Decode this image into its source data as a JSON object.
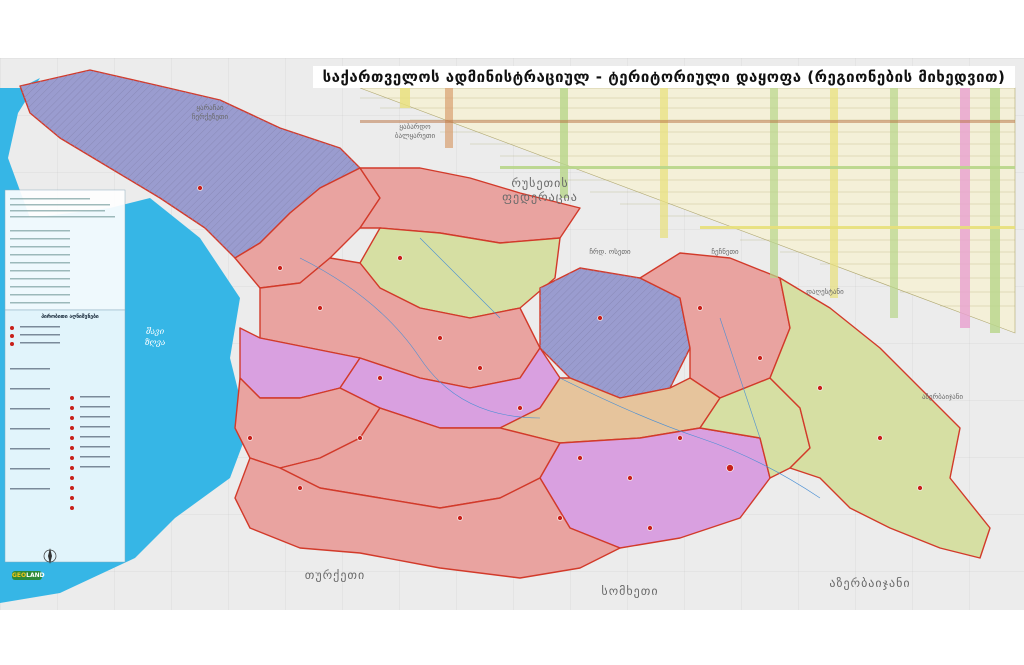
{
  "map": {
    "title": "საქართველოს ადმინისტრაციულ - ტერიტორიული დაყოფა (რეგიონების მიხედვით)",
    "countries": {
      "russia": "რუსეთის ფედერაცია",
      "turkey": "თურქეთი",
      "armenia": "სომხეთი",
      "azerbaijan": "აზერბაიჯანი"
    },
    "sea": "შავი ზღვა",
    "regions_small": {
      "north_west": "ყარაჩაი ჩერქეზეთი",
      "north_center": "ყაბარდო ბალყარეთი",
      "north_ossetia": "ჩრდ. ოსეთი",
      "chechnya": "ჩეჩნეთი",
      "dagestan": "დაღესტანი",
      "azerbaijan_small": "აზერბაიჯანი"
    },
    "legend_header": "პირობითი აღნიშვნები",
    "logo": {
      "geo": "GEO",
      "land": "LAND"
    }
  },
  "colors": {
    "sea": "#36b6e6",
    "land_outside": "#ececec",
    "region_pink": "#e9a3a0",
    "region_purple": "#d9a0e0",
    "region_blue": "#9a9ccf",
    "region_green": "#d6dfa3",
    "region_tan": "#e6c49c",
    "border_red": "#d23a2a",
    "table_yellow": "#e8e07a",
    "table_green": "#b8d68a",
    "table_pink": "#e8a0d0"
  }
}
